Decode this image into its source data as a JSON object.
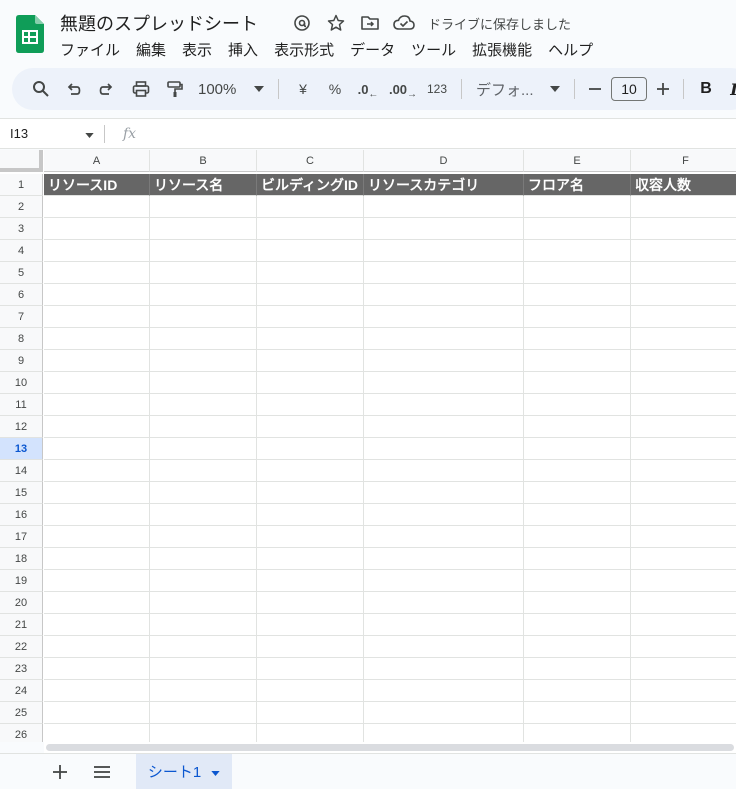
{
  "app": {
    "doc_title": "無題のスプレッドシート",
    "saved_status": "ドライブに保存しました",
    "brand_color": "#0f9d58"
  },
  "menu": [
    "ファイル",
    "編集",
    "表示",
    "挿入",
    "表示形式",
    "データ",
    "ツール",
    "拡張機能",
    "ヘルプ"
  ],
  "toolbar": {
    "zoom": "100%",
    "currency": "¥",
    "percent": "%",
    "decrease_decimal": ".0",
    "increase_decimal": ".00",
    "number_format": "123",
    "font": "デフォ...",
    "font_size": "10",
    "bold": "B",
    "italic": "I"
  },
  "formula_bar": {
    "cell_ref": "I13",
    "fx": "fx",
    "value": ""
  },
  "sheet": {
    "columns": [
      "A",
      "B",
      "C",
      "D",
      "E",
      "F"
    ],
    "header_row": [
      "リソースID",
      "リソース名",
      "ビルディングID",
      "リソースカテゴリ",
      "フロア名",
      "収容人数"
    ],
    "row_count": 26,
    "selected_row": 13,
    "header_bg": "#666666"
  },
  "bottom": {
    "sheet_tab": "シート1"
  }
}
